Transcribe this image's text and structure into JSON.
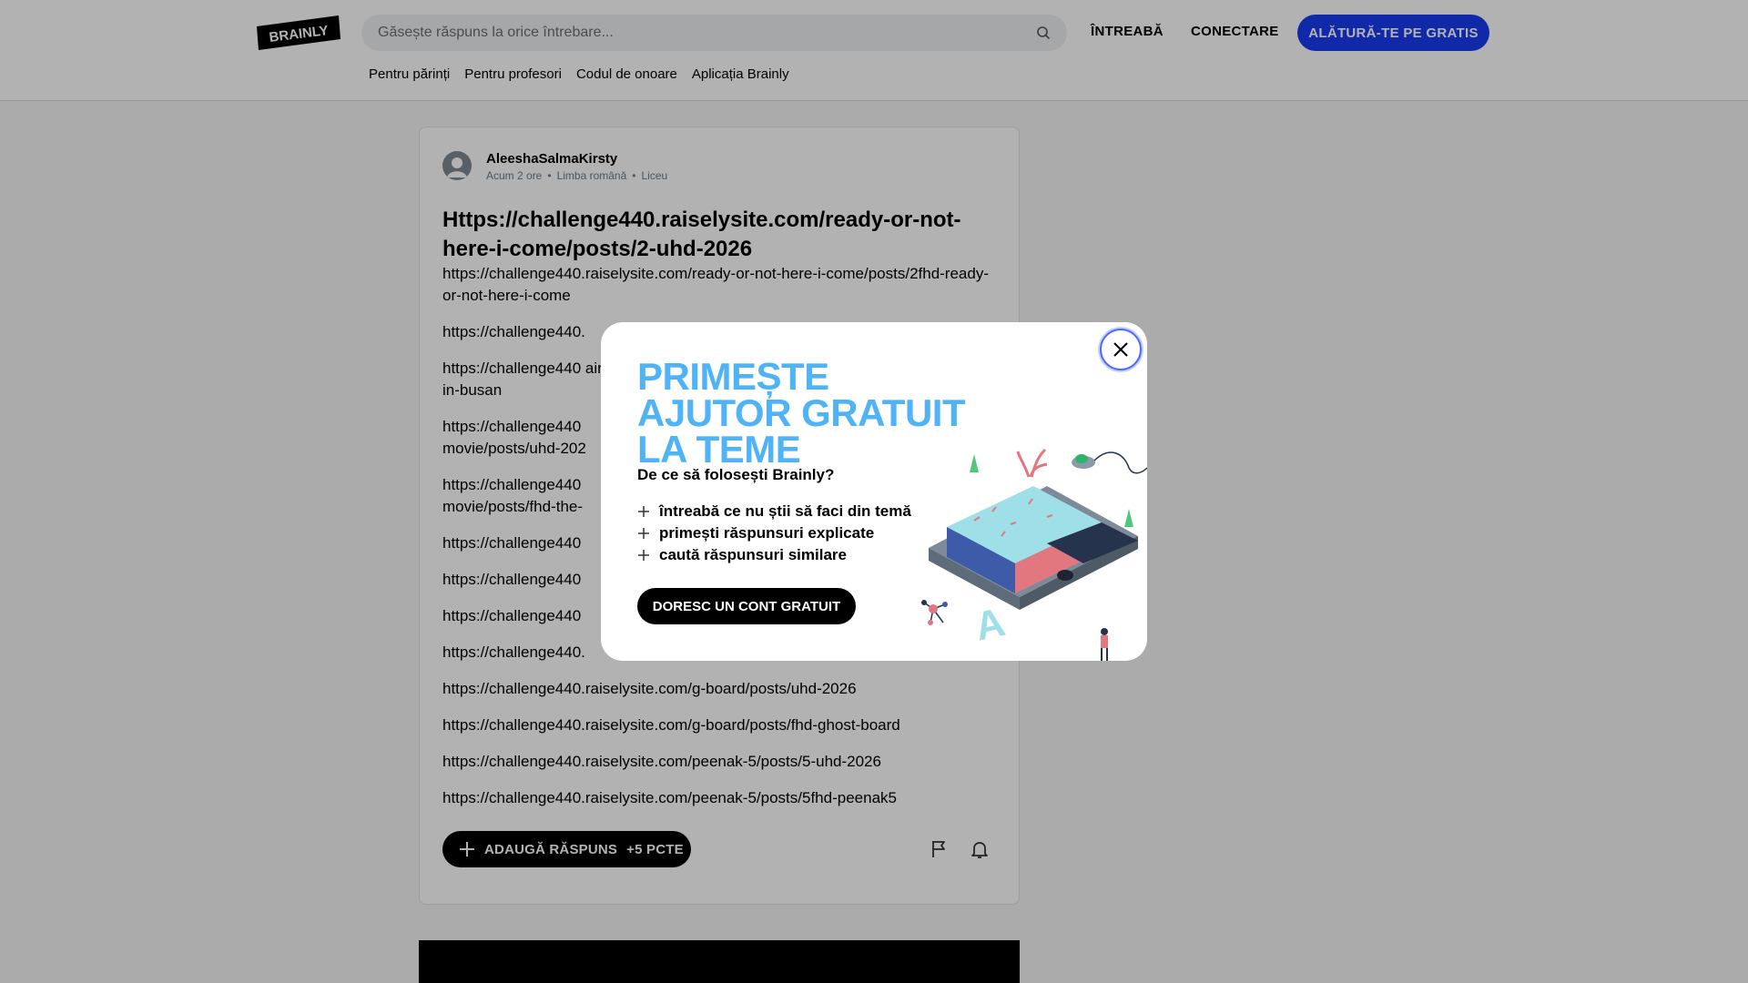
{
  "header": {
    "search_placeholder": "Găsește răspuns la orice întrebare...",
    "ask_label": "ÎNTREABĂ",
    "login_label": "CONECTARE",
    "join_label": "ALĂTURĂ-TE PE GRATIS",
    "accent_color": "#163bf3",
    "subnav": [
      "Pentru părinți",
      "Pentru profesori",
      "Codul de onoare",
      "Aplicația Brainly"
    ]
  },
  "question": {
    "author": "AleeshaSalmaKirsty",
    "time": "Acum 2 ore",
    "subject": "Limba română",
    "level": "Liceu",
    "title": "Https://challenge440.raiselysite.com/ready-or-not-here-i-come/posts/2-uhd-2026",
    "links": [
      "https://challenge440.raiselysite.com/ready-or-not-here-i-come/posts/2fhd-ready-or-not-here-i-come",
      "https://challenge440.",
      "https://challenge440 airy-in-busan",
      "https://challenge440 movie/posts/uhd-202",
      "https://challenge440 movie/posts/fhd-the-",
      "https://challenge440",
      "https://challenge440",
      "https://challenge440",
      "https://challenge440.",
      "https://challenge440.raiselysite.com/g-board/posts/uhd-2026",
      "https://challenge440.raiselysite.com/g-board/posts/fhd-ghost-board",
      "https://challenge440.raiselysite.com/peenak-5/posts/5-uhd-2026",
      "https://challenge440.raiselysite.com/peenak-5/posts/5fhd-peenak5"
    ],
    "answer_label": "ADAUGĂ RĂSPUNS",
    "answer_points": "+5 PCTE"
  },
  "modal": {
    "title": "PRIMEȘTE AJUTOR GRATUIT LA TEME",
    "title_color": "#4fb3f6",
    "why": "De ce să folosești Brainly?",
    "benefits": [
      "întreabă ce nu știi să faci din temă",
      "primești răspunsuri explicate",
      "caută răspunsuri similare"
    ],
    "cta": "DORESC UN CONT GRATUIT"
  },
  "icons": {
    "search": "search-icon",
    "close": "close-icon",
    "plus": "plus-icon",
    "report": "flag-icon",
    "follow": "bell-icon"
  }
}
